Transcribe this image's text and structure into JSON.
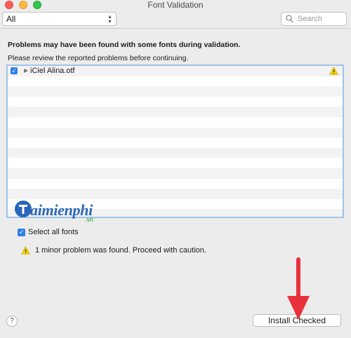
{
  "window": {
    "title": "Font Validation"
  },
  "toolbar": {
    "filter_value": "All",
    "search_placeholder": "Search"
  },
  "main": {
    "heading": "Problems may have been found with some fonts during validation.",
    "subheading": "Please review the reported problems before continuing.",
    "fonts": [
      {
        "name": "iCiel Alina.otf",
        "checked": true,
        "status": "warning"
      }
    ]
  },
  "watermark": {
    "brand": "aimienphi",
    "suffix": ".vn"
  },
  "footer": {
    "select_all_label": "Select all fonts",
    "notice": "1 minor problem was found. Proceed with caution.",
    "help_label": "?",
    "install_label": "Install Checked"
  },
  "colors": {
    "accent": "#2d7fe6",
    "list_border": "#9fc4ea",
    "arrow": "#e8313a",
    "warning": "#f5d000"
  }
}
